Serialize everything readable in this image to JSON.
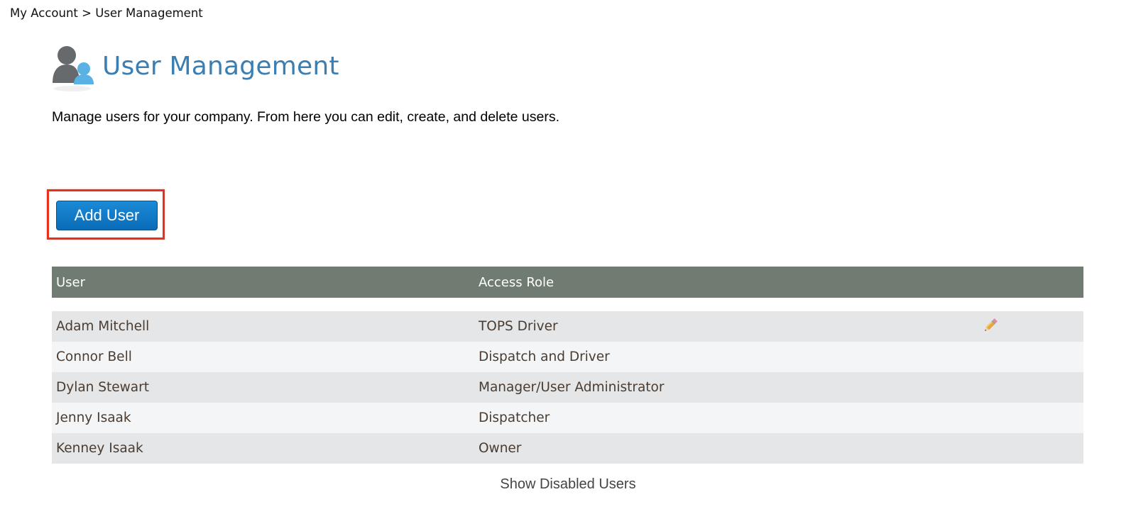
{
  "breadcrumb": {
    "root": "My Account",
    "separator": ">",
    "current": "User Management"
  },
  "header": {
    "icon": "users-icon",
    "title": "User Management"
  },
  "description": "Manage users for your company. From here you can edit, create, and delete users.",
  "actions": {
    "add_user_label": "Add User"
  },
  "table": {
    "columns": [
      "User",
      "Access Role"
    ],
    "rows": [
      {
        "user": "Adam Mitchell",
        "role": "TOPS Driver",
        "edit_icon": "pencil-icon"
      },
      {
        "user": "Connor Bell",
        "role": "Dispatch and Driver"
      },
      {
        "user": "Dylan Stewart",
        "role": "Manager/User Administrator"
      },
      {
        "user": "Jenny Isaak",
        "role": "Dispatcher"
      },
      {
        "user": "Kenney Isaak",
        "role": "Owner"
      }
    ]
  },
  "footer": {
    "show_disabled_label": "Show Disabled Users"
  },
  "colors": {
    "title": "#3a7eb2",
    "button": "#0a6cb8",
    "table_header": "#707c72",
    "highlight": "#e8301f"
  }
}
